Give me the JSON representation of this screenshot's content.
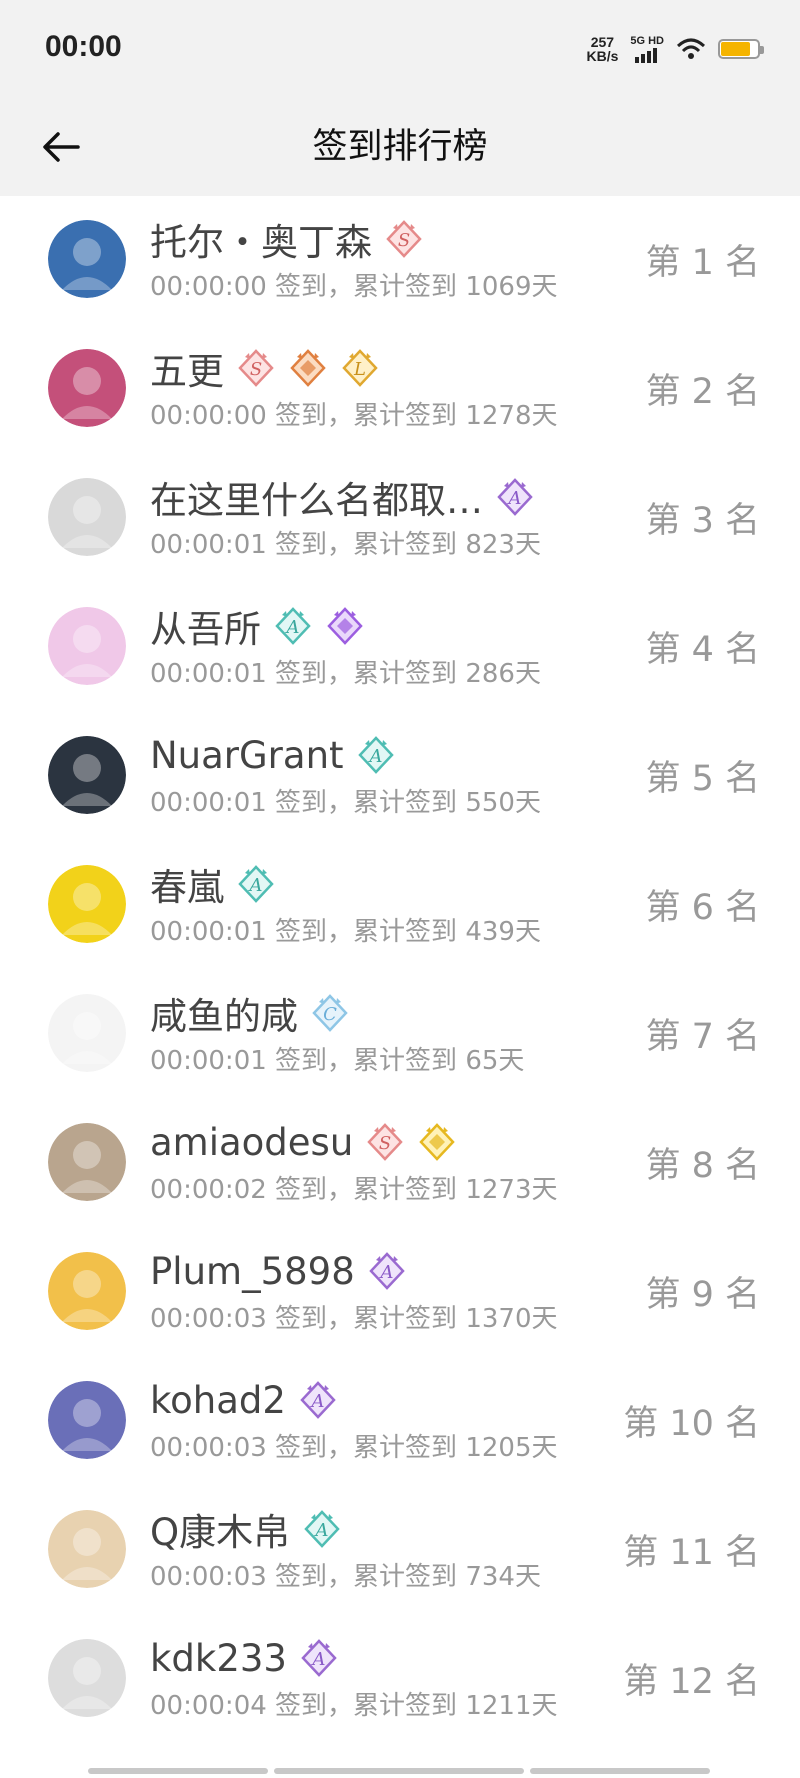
{
  "status": {
    "time": "00:00",
    "speed_value": "257",
    "speed_unit": "KB/s",
    "network": "5G HD",
    "battery_level": 0.75,
    "battery_color": "#f5b400"
  },
  "header": {
    "title": "签到排行榜",
    "back_icon": "back-arrow-icon"
  },
  "entries": [
    {
      "name": "托尔・奥丁森",
      "time": "00:00:00",
      "total": "1069天",
      "rank": "第 1 名",
      "avatar_color": "#3a6fb0",
      "badges": [
        "badge-s-pink"
      ]
    },
    {
      "name": "五更",
      "time": "00:00:00",
      "total": "1278天",
      "rank": "第 2 名",
      "avatar_color": "#c4507a",
      "badges": [
        "badge-s-pink",
        "badge-crest-orange",
        "badge-l-gold"
      ]
    },
    {
      "name": "在这里什么名都取…",
      "time": "00:00:01",
      "total": "823天",
      "rank": "第 3 名",
      "avatar_color": "#d9d9d9",
      "badges": [
        "badge-a-purple"
      ]
    },
    {
      "name": "从吾所",
      "time": "00:00:01",
      "total": "286天",
      "rank": "第 4 名",
      "avatar_color": "#f0c8e8",
      "badges": [
        "badge-a-teal",
        "badge-gem-purple"
      ]
    },
    {
      "name": "NuarGrant",
      "time": "00:00:01",
      "total": "550天",
      "rank": "第 5 名",
      "avatar_color": "#2b3440",
      "badges": [
        "badge-a-teal"
      ]
    },
    {
      "name": "春嵐",
      "time": "00:00:01",
      "total": "439天",
      "rank": "第 6 名",
      "avatar_color": "#f2d21a",
      "badges": [
        "badge-a-teal"
      ]
    },
    {
      "name": "咸鱼的咸",
      "time": "00:00:01",
      "total": "65天",
      "rank": "第 7 名",
      "avatar_color": "#f4f4f4",
      "badges": [
        "badge-c-blue"
      ]
    },
    {
      "name": "amiaodesu",
      "time": "00:00:02",
      "total": "1273天",
      "rank": "第 8 名",
      "avatar_color": "#b9a58e",
      "badges": [
        "badge-s-pink",
        "badge-gem-gold"
      ]
    },
    {
      "name": "Plum_5898",
      "time": "00:00:03",
      "total": "1370天",
      "rank": "第 9 名",
      "avatar_color": "#f2c04a",
      "badges": [
        "badge-a-purple"
      ]
    },
    {
      "name": "kohad2",
      "time": "00:00:03",
      "total": "1205天",
      "rank": "第 10 名",
      "avatar_color": "#6a6fb8",
      "badges": [
        "badge-a-purple"
      ]
    },
    {
      "name": "Q康木帛",
      "time": "00:00:03",
      "total": "734天",
      "rank": "第 11 名",
      "avatar_color": "#e8d2b0",
      "badges": [
        "badge-a-teal"
      ]
    },
    {
      "name": "kdk233",
      "time": "00:00:04",
      "total": "1211天",
      "rank": "第 12 名",
      "avatar_color": "#ddd",
      "badges": [
        "badge-a-purple"
      ]
    }
  ],
  "strings": {
    "checkin_label": "签到，累计签到"
  }
}
